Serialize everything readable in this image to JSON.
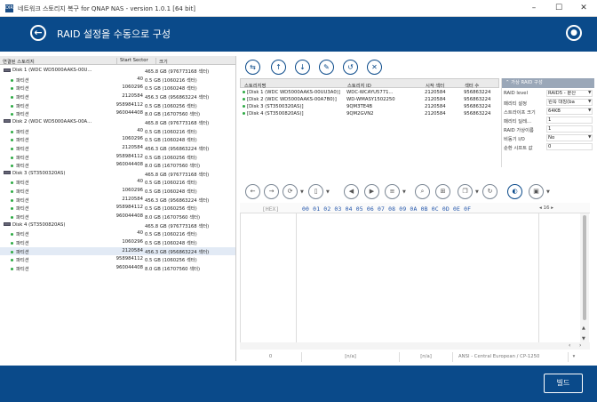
{
  "window": {
    "title": "네트워크 스토리지 복구 for QNAP NAS - version 1.0.1 [64 bit]",
    "app_icon_text": "DIR",
    "controls": {
      "minimize": "–",
      "maximize": "☐",
      "close": "✕"
    }
  },
  "header": {
    "title": "RAID 설정을 수동으로 구성",
    "back_icon": "back-arrow-icon",
    "user_icon": "user-icon"
  },
  "colors": {
    "header_bg": "#0a4a8a",
    "accent": "#0a4a8a",
    "partition_dot": "#2eaa44",
    "panel_title_bg": "#9aa7b8"
  },
  "left_panel": {
    "columns": [
      "연결된 스토리지",
      "Start Sector",
      "크기"
    ],
    "rows": [
      {
        "type": "disk",
        "name": "Disk 1 (WDC WD5000AAKS-00U...",
        "start": "",
        "size": "465.8 GB (976773168 섹터)"
      },
      {
        "type": "part",
        "name": "파티션",
        "start": "40",
        "size": "0.5 GB (1060216 섹터)"
      },
      {
        "type": "part",
        "name": "파티션",
        "start": "1060296",
        "size": "0.5 GB (1060248 섹터)"
      },
      {
        "type": "part",
        "name": "파티션",
        "start": "2120584",
        "size": "456.3 GB (956863224 섹터)"
      },
      {
        "type": "part",
        "name": "파티션",
        "start": "958984112",
        "size": "0.5 GB (1060256 섹터)"
      },
      {
        "type": "part",
        "name": "파티션",
        "start": "960044408",
        "size": "8.0 GB (16707560 섹터)"
      },
      {
        "type": "disk",
        "name": "Disk 2 (WDC WD5000AAKS-00A...",
        "start": "",
        "size": "465.8 GB (976773168 섹터)"
      },
      {
        "type": "part",
        "name": "파티션",
        "start": "40",
        "size": "0.5 GB (1060216 섹터)"
      },
      {
        "type": "part",
        "name": "파티션",
        "start": "1060296",
        "size": "0.5 GB (1060248 섹터)"
      },
      {
        "type": "part",
        "name": "파티션",
        "start": "2120584",
        "size": "456.3 GB (956863224 섹터)"
      },
      {
        "type": "part",
        "name": "파티션",
        "start": "958984112",
        "size": "0.5 GB (1060256 섹터)"
      },
      {
        "type": "part",
        "name": "파티션",
        "start": "960044408",
        "size": "8.0 GB (16707560 섹터)"
      },
      {
        "type": "disk",
        "name": "Disk 3 (ST3500320AS)",
        "start": "",
        "size": "465.8 GB (976773168 섹터)"
      },
      {
        "type": "part",
        "name": "파티션",
        "start": "40",
        "size": "0.5 GB (1060216 섹터)"
      },
      {
        "type": "part",
        "name": "파티션",
        "start": "1060296",
        "size": "0.5 GB (1060248 섹터)"
      },
      {
        "type": "part",
        "name": "파티션",
        "start": "2120584",
        "size": "456.3 GB (956863224 섹터)"
      },
      {
        "type": "part",
        "name": "파티션",
        "start": "958984112",
        "size": "0.5 GB (1060256 섹터)"
      },
      {
        "type": "part",
        "name": "파티션",
        "start": "960044408",
        "size": "8.0 GB (16707560 섹터)"
      },
      {
        "type": "disk",
        "name": "Disk 4 (ST3500820AS)",
        "start": "",
        "size": "465.8 GB (976773168 섹터)"
      },
      {
        "type": "part",
        "name": "파티션",
        "start": "40",
        "size": "0.5 GB (1060216 섹터)"
      },
      {
        "type": "part",
        "name": "파티션",
        "start": "1060296",
        "size": "0.5 GB (1060248 섹터)"
      },
      {
        "type": "part",
        "name": "파티션",
        "start": "2120584",
        "size": "456.3 GB (956863224 섹터)",
        "selected": true
      },
      {
        "type": "part",
        "name": "파티션",
        "start": "958984112",
        "size": "0.5 GB (1060256 섹터)"
      },
      {
        "type": "part",
        "name": "파티션",
        "start": "960044408",
        "size": "8.0 GB (16707560 섹터)"
      }
    ]
  },
  "raid_toolbar": {
    "buttons": [
      "add-disk-icon",
      "move-up-icon",
      "move-down-icon",
      "edit-icon",
      "undo-icon",
      "remove-icon"
    ],
    "glyphs": [
      "⇆",
      "↑",
      "↓",
      "✎",
      "↺",
      "✕"
    ]
  },
  "disk_table": {
    "columns": [
      "스토리지명",
      "스토리지 ID",
      "시작 섹터",
      "섹터 수"
    ],
    "rows": [
      {
        "name": "[Disk 1 (WDC WD5000AAKS-00UU3A0)]",
        "id": "WDC-WCAYU5771...",
        "start": "2120584",
        "count": "956863224"
      },
      {
        "name": "[Disk 2 (WDC WD5000AAKS-00A7B0)]",
        "id": "WD-WMASY1502250",
        "start": "2120584",
        "count": "956863224"
      },
      {
        "name": "[Disk 3 (ST3500320AS)]",
        "id": "9QM3TE4B",
        "start": "2120584",
        "count": "956863224"
      },
      {
        "name": "[Disk 4 (ST3500820AS)]",
        "id": "9QM2GVN2",
        "start": "2120584",
        "count": "956863224"
      }
    ]
  },
  "raid_config": {
    "title": "가상 RAID 구성",
    "fields": [
      {
        "label": "RAID level",
        "value": "RAID5 - 분산"
      },
      {
        "label": "패리티 설정",
        "value": "왼쪽 대칭(ba"
      },
      {
        "label": "스트라이프 크기",
        "value": "64KB"
      },
      {
        "label": "패리티 딜레...",
        "value": "1"
      },
      {
        "label": "RAID 가상이름",
        "value": "1"
      },
      {
        "label": "비동기 I/O",
        "value": "No"
      },
      {
        "label": "순환 시프트 값",
        "value": "0"
      }
    ]
  },
  "hex_toolbar": {
    "buttons": [
      "back-icon",
      "forward-icon",
      "refresh-icon",
      "bookmark-icon",
      "prev-match-icon",
      "next-match-icon",
      "list-icon",
      "search-icon",
      "grid-icon",
      "copy-icon",
      "reload-icon",
      "toggle-icon",
      "save-icon"
    ]
  },
  "hex_view": {
    "label": "[HEX]",
    "columns": "00 01 02 03 04 05 06 07 08 09 0A 0B 0C 0D 0E 0F",
    "bytes_per_row": "16"
  },
  "status_bar": {
    "offset": "0",
    "value1": "[n/a]",
    "value2": "[n/a]",
    "encoding": "ANSI - Central European / CP-1250"
  },
  "footer": {
    "build_label": "빌드"
  }
}
